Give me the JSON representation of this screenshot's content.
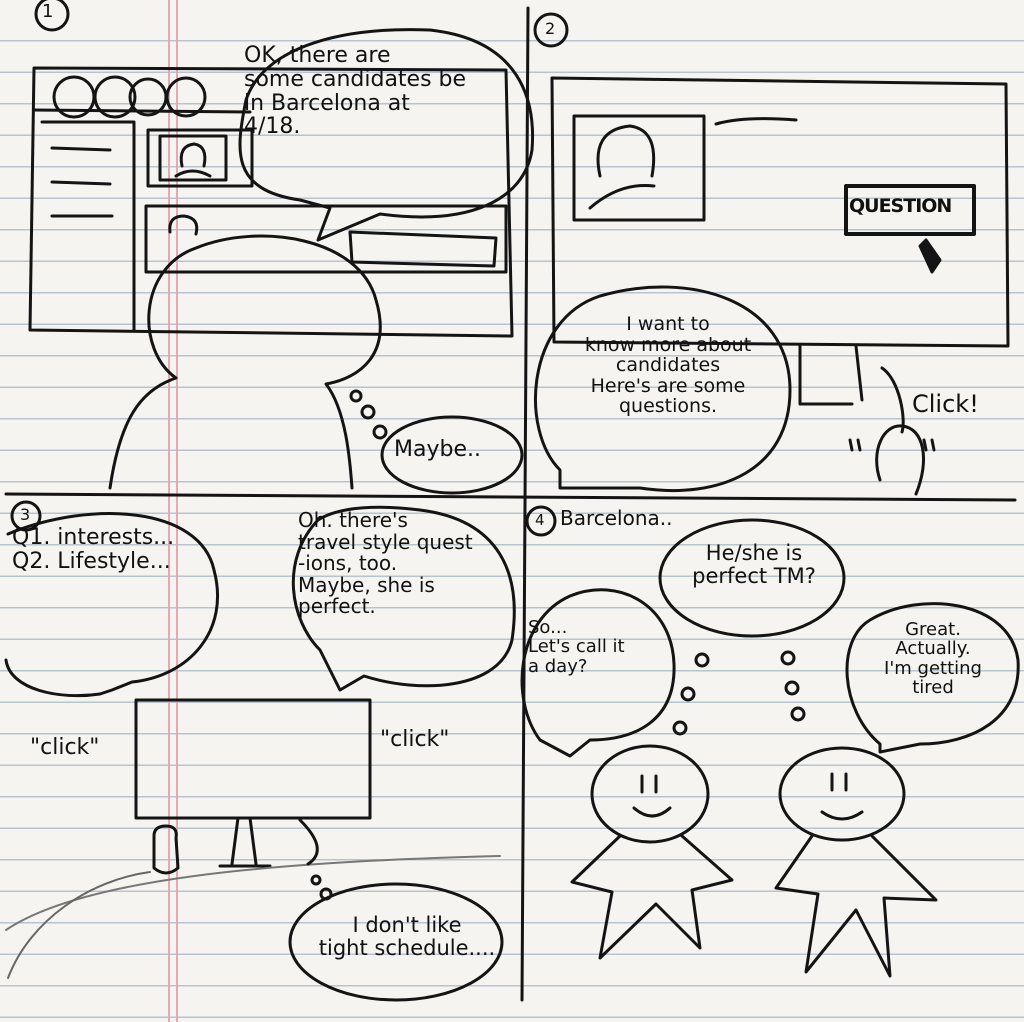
{
  "panels": [
    {
      "number": "1",
      "speech": "OK, there are\nsome candidates be\nin Barcelona at\n4/18.",
      "thought": "Maybe.."
    },
    {
      "number": "2",
      "button_label": "QUESTION",
      "speech": "I want to\nknow more about\ncandidates\nHere's are some\nquestions.",
      "click_sound": "Click!"
    },
    {
      "number": "3",
      "left_bubble": "Q1. interests...\nQ2. Lifestyle...",
      "speech": "Oh. there's\ntravel style quest\n-ions, too.\nMaybe, she is\nperfect.",
      "click_left": "\"click\"",
      "click_right": "\"click\"",
      "thought": "I don't like\ntight schedule...."
    },
    {
      "number": "4",
      "title": "Barcelona..",
      "thought_top": "He/she is\nperfect TM?",
      "left_speech": "So...\nLet's call it\na day?",
      "right_speech": "Great.\nActually.\nI'm getting\ntired"
    }
  ],
  "colors": {
    "paper": "#f5f4f1",
    "rule": "#b9c3cf",
    "margin": "#e6a9b3",
    "ink": "#141414",
    "background": "#c9a77a"
  }
}
